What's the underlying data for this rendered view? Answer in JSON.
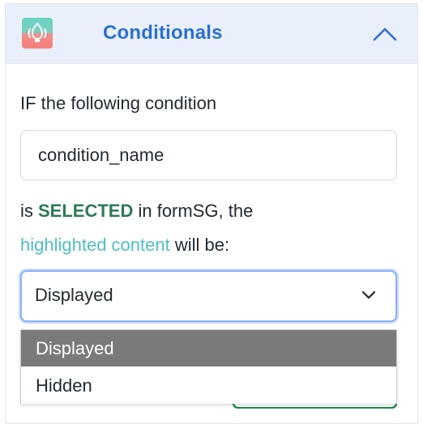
{
  "header": {
    "icon": "condition-logo-icon",
    "title": "Conditionals",
    "collapse_icon": "chevron-up-icon",
    "title_color": "#2c6fd1",
    "background": "#e9f0fb"
  },
  "body": {
    "intro": "IF the following condition",
    "condition_input_value": "condition_name",
    "line2_prefix": "is ",
    "line2_emphasis": "SELECTED",
    "line2_suffix": " in formSG, the",
    "line3_highlight": "highlighted content",
    "line3_suffix": " will be:"
  },
  "select": {
    "value": "Displayed",
    "chevron_icon": "chevron-down-icon",
    "options": [
      "Displayed",
      "Hidden"
    ],
    "highlighted_option": "Displayed"
  },
  "colors": {
    "emphasis": "#2c7a55",
    "highlight": "#4ebfc4",
    "focus_border": "#8db2f2",
    "option_highlight_bg": "#7a7a7a",
    "button_green": "#1f8a4c"
  }
}
